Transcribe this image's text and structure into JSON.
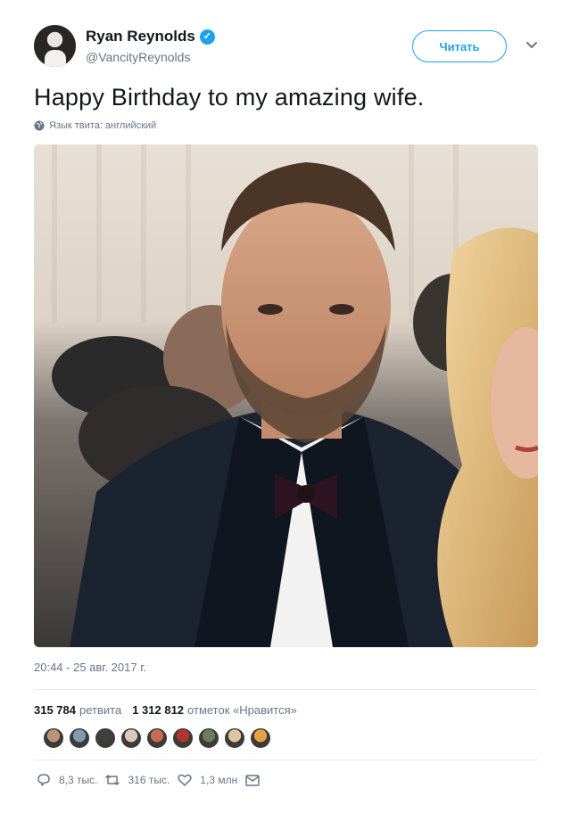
{
  "author": {
    "name": "Ryan Reynolds",
    "handle": "@VancityReynolds",
    "verified": true
  },
  "follow_button": {
    "label": "Читать"
  },
  "tweet": {
    "text": "Happy Birthday to my amazing wife.",
    "language_note": "Язык твита: английский",
    "timestamp": "20:44 - 25 авг. 2017 г."
  },
  "stats": {
    "retweets_count": "315 784",
    "retweets_label": "ретвита",
    "likes_count": "1 312 812",
    "likes_label": "отметок «Нравится»"
  },
  "likers": [
    {
      "color": "#b8957a"
    },
    {
      "color": "#7e9bb3"
    },
    {
      "color": "#3f3f3f"
    },
    {
      "color": "#d9c7c0"
    },
    {
      "color": "#c96b52"
    },
    {
      "color": "#b1372e"
    },
    {
      "color": "#6b7f5e"
    },
    {
      "color": "#e2c3a0"
    },
    {
      "color": "#e0a441"
    }
  ],
  "actions": {
    "replies": "8,3 тыс.",
    "retweets": "316 тыс.",
    "likes": "1,3 млн"
  },
  "colors": {
    "accent": "#1da1f2",
    "text": "#14171a",
    "muted": "#657786"
  },
  "icons": {
    "verified": "verified-badge-icon",
    "caret": "chevron-down-icon",
    "globe": "globe-icon",
    "reply": "reply-icon",
    "retweet": "retweet-icon",
    "like": "heart-icon",
    "message": "envelope-icon"
  }
}
